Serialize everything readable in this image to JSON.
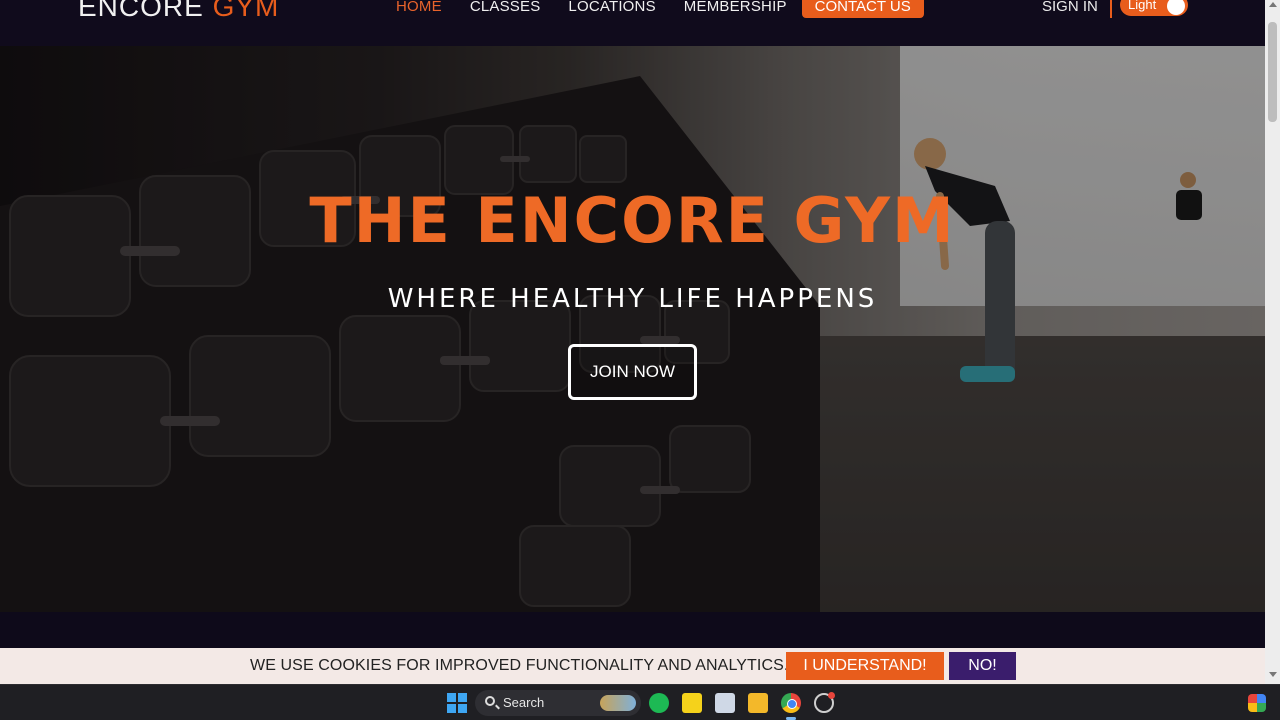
{
  "nav": {
    "logo_main": "ENCORE ",
    "logo_accent": "GYM",
    "links": [
      "HOME",
      "CLASSES",
      "LOCATIONS",
      "MEMBERSHIP"
    ],
    "contact_label": "CONTACT US",
    "sign_in_label": "SIGN IN",
    "theme_toggle_label": "Light"
  },
  "hero": {
    "title": "THE ENCORE GYM",
    "subtitle": "WHERE HEALTHY LIFE HAPPENS",
    "cta_label": "JOIN NOW"
  },
  "cookie_banner": {
    "message": "WE USE COOKIES FOR IMPROVED FUNCTIONALITY AND ANALYTICS.",
    "accept_label": "I UNDERSTAND!",
    "decline_label": "NO!"
  },
  "taskbar": {
    "search_label": "Search",
    "icons": [
      "windows-start-icon",
      "search-icon",
      "spotify-icon",
      "sticky-notes-icon",
      "photos-icon",
      "file-explorer-icon",
      "chrome-icon",
      "settings-icon",
      "copilot-icon"
    ]
  },
  "colors": {
    "accent": "#e85d1c",
    "nav_bg": "#100b1c",
    "decline_bg": "#3a1d6c",
    "cookie_bg": "#f3e9e6"
  }
}
